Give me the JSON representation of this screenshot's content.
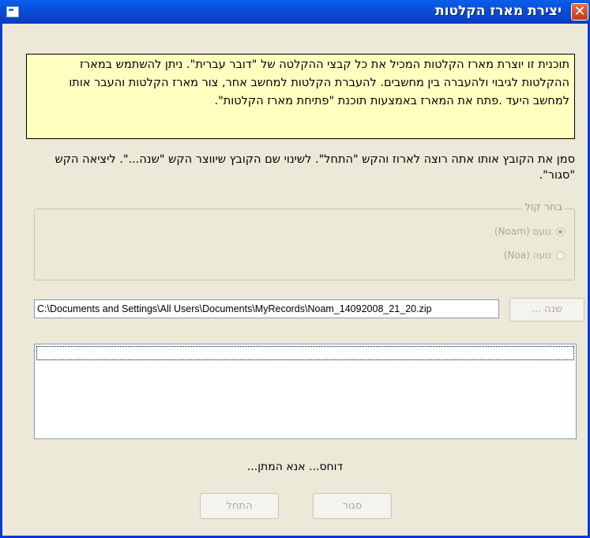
{
  "window": {
    "title": "יצירת מארז הקלטות"
  },
  "info": {
    "text": "תוכנית זו יוצרת מארז הקלטות המכיל את כל קבצי ההקלטה של \"דובר עברית\". ניתן להשתמש במארז ההקלטות לגיבוי ולהעברה בין מחשבים. להעברת הקלטות למחשב אחר, צור מארז הקלטות והעבר אותו למחשב היעד .פתח את המארז באמצעות תוכנת \"פתיחת מארז הקלטות\"."
  },
  "instructions": {
    "text": "סמן את הקובץ אותו אתה רוצה לארוז והקש \"התחל\". לשינוי שם הקובץ שיווצר הקש \"שנה...\". ליציאה הקש \"סגור\"."
  },
  "voice_group": {
    "legend": "בחר קול",
    "options": [
      {
        "label": "נועם (Noam)",
        "selected": true
      },
      {
        "label": "נועה (Noa)",
        "selected": false
      }
    ]
  },
  "file": {
    "path": "C:\\Documents and Settings\\All Users\\Documents\\MyRecords\\Noam_14092008_21_20.zip",
    "change_label": "שנה ..."
  },
  "status": {
    "text": "דוחס... אנא המתן..."
  },
  "buttons": {
    "close_label": "סגור",
    "start_label": "התחל"
  }
}
